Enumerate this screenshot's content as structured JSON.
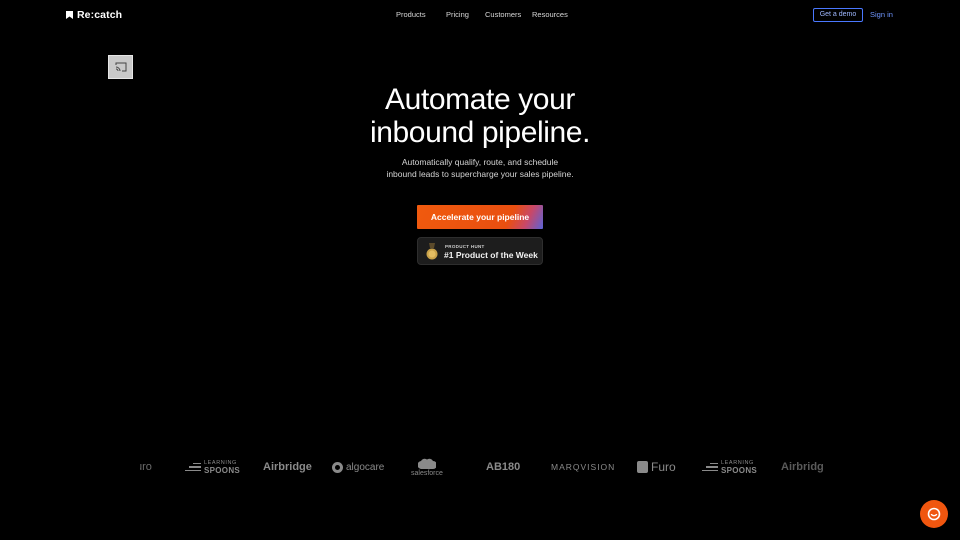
{
  "header": {
    "brand": "Re:catch",
    "nav": [
      "Products",
      "Pricing",
      "Customers",
      "Resources"
    ],
    "demo_label": "Get a demo",
    "signin_label": "Sign in"
  },
  "hero": {
    "title_line1": "Automate your",
    "title_line2": "inbound pipeline.",
    "subtitle_line1": "Automatically qualify, route, and schedule",
    "subtitle_line2": "inbound leads to supercharge your sales pipeline.",
    "cta_label": "Accelerate your pipeline",
    "badge_kicker": "PRODUCT HUNT",
    "badge_title": "#1 Product of the Week"
  },
  "customer_logos": {
    "furo_partial": "uro",
    "learning_spoons_top": "LEARNING",
    "learning_spoons_bottom": "SPOONS",
    "airbridge": "Airbridge",
    "algocare": "algocare",
    "salesforce": "salesforce",
    "ab180": "AB180",
    "marqvision": "MARQVISION",
    "furo": "Furo",
    "airbridge_partial": "Airbridg"
  },
  "icons": {
    "logo": "recatch-logo-mark",
    "cast": "cast-icon",
    "medal": "medal-icon",
    "chat": "chat-icon"
  },
  "colors": {
    "background": "#000000",
    "accent_orange": "#f05a0e",
    "link_blue": "#6f96ff"
  }
}
